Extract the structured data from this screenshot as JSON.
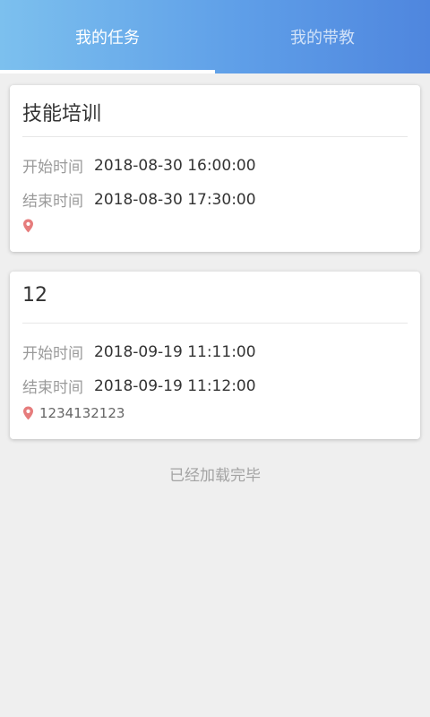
{
  "tabs": [
    {
      "label": "我的任务",
      "active": true
    },
    {
      "label": "我的带教",
      "active": false
    }
  ],
  "colors": {
    "accent_start": "#7cc0ee",
    "accent_end": "#4f86de",
    "pin": "#e67c7c"
  },
  "tasks": [
    {
      "title": "技能培训",
      "start_label": "开始时间",
      "start_time": "2018-08-30 16:00:00",
      "end_label": "结束时间",
      "end_time": "2018-08-30 17:30:00",
      "location": "",
      "location_icon": "map-pin-icon"
    },
    {
      "title": "12",
      "start_label": "开始时间",
      "start_time": "2018-09-19 11:11:00",
      "end_label": "结束时间",
      "end_time": "2018-09-19 11:12:00",
      "location": "1234132123",
      "location_icon": "map-pin-icon"
    }
  ],
  "footer": {
    "loaded_text": "已经加载完毕"
  }
}
